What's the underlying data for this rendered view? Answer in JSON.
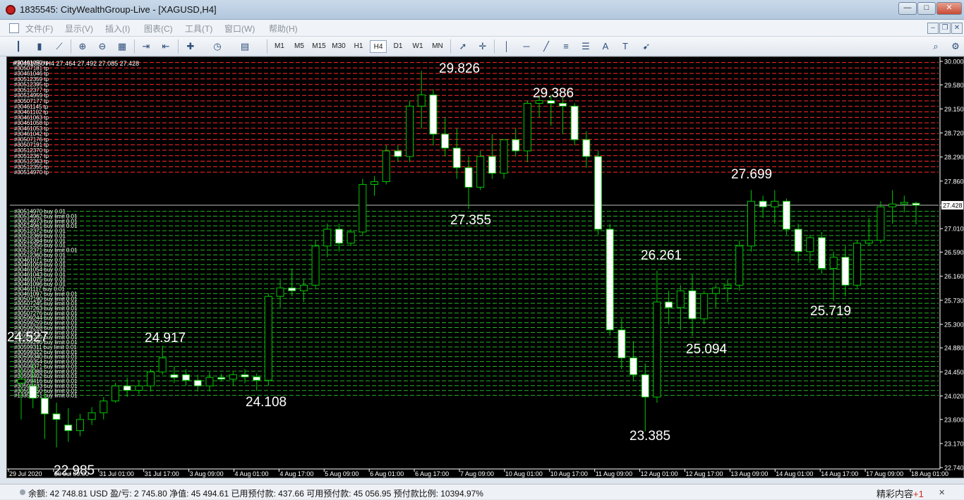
{
  "window": {
    "title": "1835545: CityWealthGroup-Live - [XAGUSD,H4]",
    "minimize_glyph": "—",
    "maximize_glyph": "□",
    "close_glyph": "✕"
  },
  "menu": {
    "items": [
      "文件(F)",
      "显示(V)",
      "插入(I)",
      "图表(C)",
      "工具(T)",
      "窗口(W)",
      "帮助(H)"
    ],
    "mdi_min": "–",
    "mdi_restore": "❐",
    "mdi_close": "✕"
  },
  "toolbar": {
    "timeframes": [
      "M1",
      "M5",
      "M15",
      "M30",
      "H1",
      "H4",
      "D1",
      "W1",
      "MN"
    ],
    "active_timeframe": "H4",
    "icons": [
      "bar-chart-icon",
      "candlestick-icon",
      "line-chart-icon",
      "zoom-in-icon",
      "zoom-out-icon",
      "tile-windows-icon",
      "auto-scroll-icon",
      "chart-shift-icon",
      "indicators-icon",
      "periods-icon",
      "templates-icon",
      "cursor-icon",
      "crosshair-icon",
      "vertical-line-icon",
      "horizontal-line-icon",
      "trendline-icon",
      "equidistant-channel-icon",
      "fibonacci-icon",
      "text-icon",
      "text-label-icon",
      "arrows-icon",
      "search-icon",
      "settings-icon"
    ],
    "text_tool": "A",
    "label_tool": "T"
  },
  "chart": {
    "symbol_header": "#30461050 H4  27.464 27.492 27.085 27.428",
    "current_price_label": "27.428",
    "y_ticks": [
      "30.000",
      "29.580",
      "29.150",
      "28.720",
      "28.290",
      "27.860",
      "27.428",
      "27.010",
      "26.590",
      "26.160",
      "25.730",
      "25.300",
      "24.880",
      "24.450",
      "24.020",
      "23.600",
      "23.170",
      "22.740"
    ],
    "x_ticks": [
      "29 Jul 2020",
      "30 Jul 09:00",
      "31 Jul 01:00",
      "31 Jul 17:00",
      "3 Aug 09:00",
      "4 Aug 01:00",
      "4 Aug 17:00",
      "5 Aug 09:00",
      "6 Aug 01:00",
      "6 Aug 17:00",
      "7 Aug 09:00",
      "10 Aug 01:00",
      "10 Aug 17:00",
      "11 Aug 09:00",
      "12 Aug 01:00",
      "12 Aug 17:00",
      "13 Aug 09:00",
      "14 Aug 01:00",
      "14 Aug 17:00",
      "17 Aug 09:00",
      "18 Aug 01:00"
    ],
    "annotations": [
      "29.826",
      "29.386",
      "27.355",
      "27.699",
      "26.261",
      "25.719",
      "25.094",
      "24.917",
      "24.108",
      "23.385",
      "22.985",
      "24.527"
    ],
    "tp_orders": [
      "#30461050 tp",
      "#30507181 tp",
      "#30461046 tp",
      "#30512359 tp",
      "#30512395 tp",
      "#30512377 tp",
      "#30514959 tp",
      "#30507177 tp",
      "#30461145 tp",
      "#30461102 tp",
      "#30461063 tp",
      "#30461058 tp",
      "#30461053 tp",
      "#30461042 tp",
      "#30507176 tp",
      "#30507191 tp",
      "#30512370 tp",
      "#30512367 tp",
      "#30512363 tp",
      "#30512355 tp",
      "#30514970 tp"
    ],
    "buy_orders": [
      "#30514970 buy 0.01",
      "#30514962 buy limit 0.01",
      "#30514973 buy limit 0.01",
      "#30514961 buy limit 0.01",
      "#30512372 buy 0.01",
      "#30512369 buy 0.01",
      "#30512364 buy 0.01",
      "#30512356 buy 0.01",
      "#30512371 buy limit 0.01",
      "#30512360 buy 0.01",
      "#30461071 buy 0.01",
      "#30461059 buy 0.01",
      "#30461054 buy 0.01",
      "#30461043 buy 0.01",
      "#30461075 buy 0.01",
      "#30461096 buy 0.01",
      "#30461117 buy 0.01",
      "#30461097 buy limit 0.01",
      "#30507190 buy limit 0.01",
      "#30507245 buy limit 0.01",
      "#30507263 buy limit 0.01",
      "#30507276 buy limit 0.01",
      "#30599244 buy limit 0.01",
      "#30599259 buy limit 0.01",
      "#30599268 buy limit 0.01",
      "#30599277 buy limit 0.01",
      "#30599289 buy limit 0.01",
      "#30599296 buy limit 0.01",
      "#30599311 buy limit 0.01",
      "#30599322 buy limit 0.01",
      "#30599340 buy limit 0.01",
      "#30599354 buy limit 0.01",
      "#30599371 buy limit 0.01",
      "#30599388 buy limit 0.01",
      "#30599402 buy limit 0.01",
      "#30599416 buy limit 0.01",
      "#30599433 buy limit 0.01",
      "#30599450 buy limit 0.01",
      "#18357451 buy limit 0.01"
    ],
    "colors": {
      "up": "#00c800",
      "down_fill": "#ffffff",
      "tp_line": "#ff2a2a",
      "buy_line": "#26b326",
      "axis": "#ffffff"
    }
  },
  "chart_data": {
    "type": "candlestick",
    "title": "",
    "ylim": [
      22.74,
      30.0
    ],
    "x_axis": "time",
    "series": [
      {
        "values": [
          [
            24.25,
            24.52,
            23.6,
            24.32
          ],
          [
            24.2,
            24.6,
            23.8,
            23.98
          ],
          [
            23.98,
            24.1,
            23.25,
            23.7
          ],
          [
            23.7,
            23.9,
            23.1,
            23.6
          ],
          [
            23.5,
            23.8,
            23.2,
            23.4
          ],
          [
            23.4,
            23.7,
            23.3,
            23.6
          ],
          [
            23.6,
            23.82,
            23.5,
            23.72
          ],
          [
            23.72,
            24.0,
            23.6,
            23.93
          ],
          [
            23.93,
            24.25,
            23.9,
            24.2
          ],
          [
            24.2,
            24.35,
            24.0,
            24.12
          ],
          [
            24.12,
            24.3,
            24.05,
            24.2
          ],
          [
            24.2,
            24.5,
            24.1,
            24.45
          ],
          [
            24.45,
            24.92,
            24.4,
            24.7
          ],
          [
            24.4,
            24.55,
            24.25,
            24.35
          ],
          [
            24.4,
            24.5,
            24.2,
            24.3
          ],
          [
            24.3,
            24.4,
            24.1,
            24.2
          ],
          [
            24.2,
            24.45,
            24.1,
            24.35
          ],
          [
            24.35,
            24.42,
            24.28,
            24.32
          ],
          [
            24.32,
            24.45,
            24.2,
            24.4
          ],
          [
            24.4,
            24.5,
            24.25,
            24.36
          ],
          [
            24.36,
            24.42,
            24.11,
            24.3
          ],
          [
            24.3,
            25.85,
            24.2,
            25.8
          ],
          [
            25.8,
            26.1,
            25.6,
            25.95
          ],
          [
            25.95,
            26.3,
            25.8,
            25.9
          ],
          [
            25.9,
            26.1,
            25.7,
            26.0
          ],
          [
            26.0,
            26.8,
            25.95,
            26.7
          ],
          [
            26.7,
            27.1,
            26.5,
            27.0
          ],
          [
            27.0,
            27.1,
            26.6,
            26.75
          ],
          [
            26.75,
            27.0,
            26.7,
            26.95
          ],
          [
            26.95,
            27.9,
            26.9,
            27.8
          ],
          [
            27.8,
            27.95,
            27.6,
            27.85
          ],
          [
            27.85,
            28.5,
            27.8,
            28.4
          ],
          [
            28.4,
            28.5,
            28.2,
            28.3
          ],
          [
            28.3,
            29.3,
            28.2,
            29.2
          ],
          [
            29.2,
            29.83,
            28.8,
            29.4
          ],
          [
            29.4,
            29.5,
            28.5,
            28.7
          ],
          [
            28.7,
            29.0,
            28.3,
            28.45
          ],
          [
            28.45,
            28.8,
            27.9,
            28.1
          ],
          [
            28.1,
            28.3,
            27.36,
            27.75
          ],
          [
            27.75,
            28.4,
            27.7,
            28.3
          ],
          [
            28.3,
            28.7,
            27.9,
            28.0
          ],
          [
            28.0,
            28.6,
            27.9,
            28.6
          ],
          [
            28.6,
            28.8,
            28.3,
            28.4
          ],
          [
            28.4,
            29.3,
            28.2,
            29.25
          ],
          [
            29.25,
            29.39,
            29.0,
            29.3
          ],
          [
            29.3,
            29.4,
            28.85,
            29.25
          ],
          [
            29.25,
            29.35,
            28.7,
            29.2
          ],
          [
            29.2,
            29.25,
            28.5,
            28.6
          ],
          [
            28.6,
            28.75,
            28.1,
            28.3
          ],
          [
            28.3,
            28.4,
            26.9,
            27.0
          ],
          [
            27.0,
            27.1,
            25.1,
            25.2
          ],
          [
            25.2,
            25.4,
            24.5,
            24.7
          ],
          [
            24.7,
            25.0,
            24.3,
            24.4
          ],
          [
            24.4,
            24.6,
            23.39,
            24.0
          ],
          [
            24.0,
            26.26,
            23.9,
            25.7
          ],
          [
            25.7,
            25.9,
            25.3,
            25.6
          ],
          [
            25.6,
            26.0,
            25.2,
            25.9
          ],
          [
            25.9,
            26.2,
            25.09,
            25.4
          ],
          [
            25.4,
            25.9,
            25.3,
            25.85
          ],
          [
            25.85,
            26.0,
            25.6,
            25.95
          ],
          [
            25.95,
            26.1,
            25.7,
            26.0
          ],
          [
            26.0,
            26.8,
            25.9,
            26.7
          ],
          [
            26.7,
            27.7,
            26.6,
            27.5
          ],
          [
            27.5,
            27.6,
            27.2,
            27.4
          ],
          [
            27.4,
            27.7,
            27.1,
            27.5
          ],
          [
            27.5,
            27.55,
            26.9,
            27.0
          ],
          [
            27.0,
            27.1,
            26.4,
            26.6
          ],
          [
            26.6,
            26.9,
            26.4,
            26.85
          ],
          [
            26.85,
            26.95,
            26.2,
            26.3
          ],
          [
            26.3,
            26.6,
            25.72,
            26.5
          ],
          [
            26.5,
            26.7,
            25.8,
            26.0
          ],
          [
            26.0,
            26.8,
            25.95,
            26.75
          ],
          [
            26.75,
            27.2,
            26.7,
            26.8
          ],
          [
            26.8,
            27.5,
            26.75,
            27.4
          ],
          [
            27.4,
            27.7,
            27.1,
            27.45
          ],
          [
            27.45,
            27.6,
            27.3,
            27.48
          ],
          [
            27.464,
            27.492,
            27.085,
            27.428
          ]
        ]
      }
    ]
  },
  "status": {
    "text": "余额: 42 748.81 USD   盈/亏: 2 745.80   净值: 45 494.61   已用预付款: 437.66   可用预付款: 45 056.95   预付款比例: 10394.97%",
    "promo_label": "精彩内容",
    "promo_count": "+1",
    "promo_close": "✕"
  }
}
